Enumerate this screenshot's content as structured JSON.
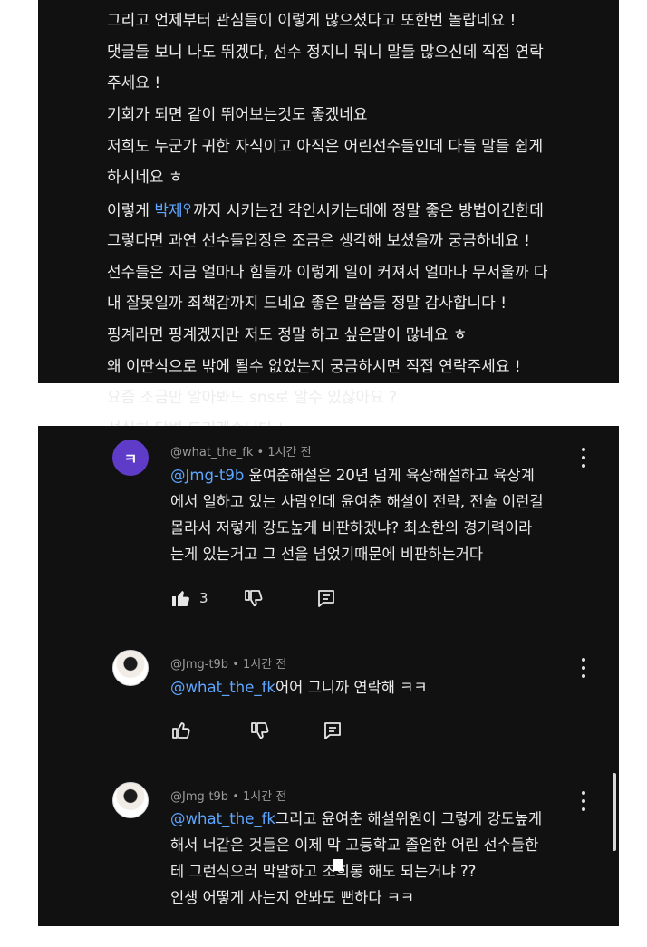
{
  "top_text": {
    "lines": [
      "그리고 언제부터 관심들이 이렇게 많으셨다고 또한번 놀랍네요 !",
      "댓글들 보니 나도 뛰겠다, 선수 정지니 뭐니 말들 많으신데 직접 연락",
      "주세요 !",
      "기회가 되면 같이 뛰어보는것도 좋겠네요",
      "저희도 누군가 귀한 자식이고 아직은 어린선수들인데 다들 말들 쉽게",
      "하시네요 ㅎ",
      "",
      "그렇다면 과연 선수들입장은 조금은 생각해 보셨을까 궁금하네요 !",
      "선수들은 지금 얼마나 힘들까 이렇게 일이 커져서 얼마나 무서울까 다",
      "내 잘못일까 죄책감까지 드네요 좋은 말씀들 정말 감사합니다 !",
      "핑계라면 핑계겠지만 저도 정말 하고 싶은말이 많네요 ㅎ",
      "왜 이딴식으로 밖에 될수 없었는지 궁금하시면 직접 연락주세요 !",
      "요즘 조금만 알아봐도 sns로 알수 있잖아요 ?",
      "성실히 답변 드리겠습니다 !"
    ],
    "line7": {
      "before": "이렇게 ",
      "link": "박제",
      "after": "까지 시키는건 각인시키는데에 정말 좋은 방법이긴한데"
    }
  },
  "comments": [
    {
      "avatar_letter": "ㅋ",
      "author": "@what_the_fk",
      "time": "1시간 전",
      "mention": "@Jmg-t9b",
      "lines": [
        " 윤여춘해설은 20년 넘게 육상해설하고 육상계",
        "에서 일하고 있는 사람인데 윤여춘 해설이 전략, 전술 이런걸",
        "몰라서 저렇게 강도높게 비판하겠냐? 최소한의 경기력이라",
        "는게 있는거고 그 선을 넘었기때문에 비판하는거다"
      ],
      "likes": "3"
    },
    {
      "author": "@Jmg-t9b",
      "time": "1시간 전",
      "mention": "@what_the_fk",
      "lines": [
        "어어 그니까 연락해 ㅋㅋ"
      ]
    },
    {
      "author": "@Jmg-t9b",
      "time": "1시간 전",
      "mention": "@what_the_fk",
      "lines": [
        "그리고 윤여춘 해설위원이 그렇게 강도높게",
        "해서 너같은 것들은 이제 막 고등학교 졸업한 어린 선수들한",
        "테 그런식으러 막말하고 조희롱 해도 되는거냐 ??",
        "인생 어떻게 사는지 안봐도 뻔하다 ㅋㅋ"
      ]
    }
  ],
  "meta_separator": "•",
  "icons": {
    "search": "search-icon",
    "like": "thumbs-up-icon",
    "dislike": "thumbs-down-icon",
    "reply": "reply-icon",
    "more": "more-vertical-icon"
  },
  "colors": {
    "background": "#111111",
    "text": "#ececec",
    "meta": "#9a9a9a",
    "link": "#5ea6ff",
    "avatar": "#5f3cc7"
  }
}
